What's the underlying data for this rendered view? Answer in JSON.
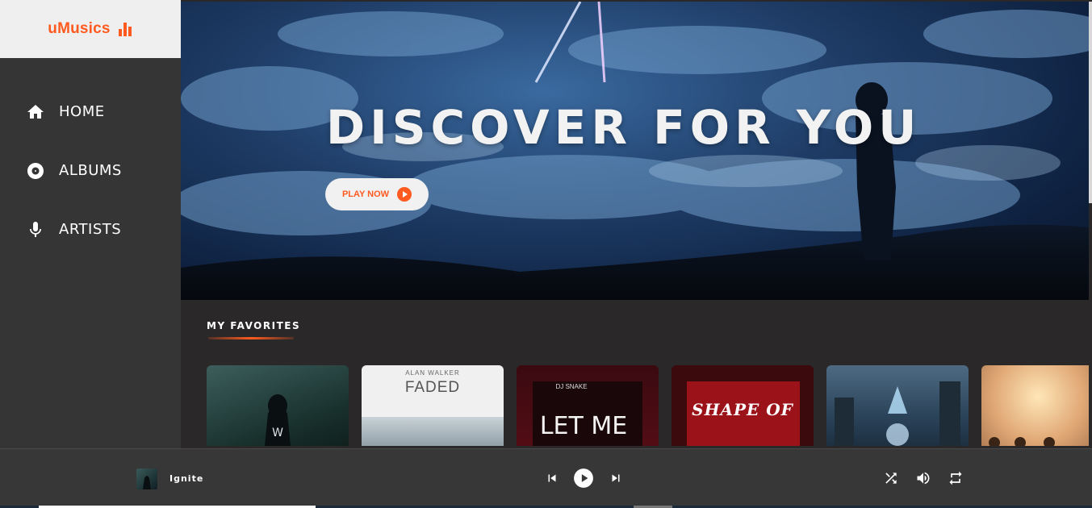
{
  "brand": {
    "name": "uMusics",
    "icon": "equalizer-icon",
    "accent": "#ff5a1f"
  },
  "nav": [
    {
      "label": "HOME",
      "icon": "home-icon"
    },
    {
      "label": "ALBUMS",
      "icon": "disc-icon"
    },
    {
      "label": "ARTISTS",
      "icon": "microphone-icon"
    }
  ],
  "hero": {
    "title": "DISCOVER FOR YOU",
    "button_label": "PLAY NOW"
  },
  "favorites": {
    "title": "MY FAVORITES",
    "cards": [
      {
        "artwork": "hooded-figure-forest",
        "text": ""
      },
      {
        "artist": "ALAN WALKER",
        "title": "FADED"
      },
      {
        "artist": "DJ SNAKE",
        "title": "LET ME"
      },
      {
        "title": "SHAPE OF"
      },
      {
        "artwork": "fantasy-city-warrior",
        "text": ""
      },
      {
        "artwork": "glowing-sphere",
        "text": ""
      }
    ]
  },
  "player": {
    "track_title": "Ignite",
    "icons": [
      "skip-previous-icon",
      "play-icon",
      "skip-next-icon",
      "shuffle-icon",
      "volume-icon",
      "repeat-icon"
    ]
  }
}
